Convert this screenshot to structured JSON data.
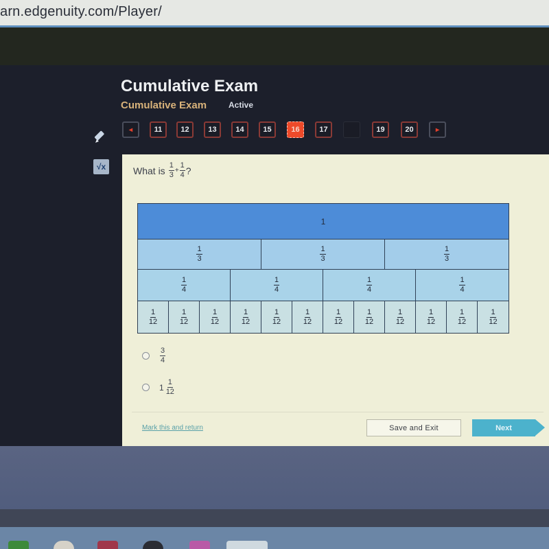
{
  "browser": {
    "url": "arn.edgenuity.com/Player/"
  },
  "header": {
    "title": "Cumulative Exam",
    "subtitle": "Cumulative Exam",
    "status": "Active"
  },
  "nav": {
    "prev_icon": "◂",
    "next_icon": "▸",
    "questions": [
      {
        "label": "11",
        "state": "answered"
      },
      {
        "label": "12",
        "state": "answered"
      },
      {
        "label": "13",
        "state": "answered"
      },
      {
        "label": "14",
        "state": "answered"
      },
      {
        "label": "15",
        "state": "answered"
      },
      {
        "label": "16",
        "state": "current"
      },
      {
        "label": "17",
        "state": "answered"
      },
      {
        "label": "",
        "state": "blank"
      },
      {
        "label": "19",
        "state": "answered"
      },
      {
        "label": "20",
        "state": "answered"
      }
    ],
    "current_color": "#ee4a2a"
  },
  "tools": {
    "pencil": "pencil-icon",
    "math": "√x"
  },
  "question": {
    "prefix": "What is",
    "frac1": {
      "num": "1",
      "den": "3"
    },
    "operator": "+",
    "frac2": {
      "num": "1",
      "den": "4"
    },
    "suffix": "?"
  },
  "fraction_model": {
    "whole": "1",
    "thirds": [
      {
        "num": "1",
        "den": "3"
      },
      {
        "num": "1",
        "den": "3"
      },
      {
        "num": "1",
        "den": "3"
      }
    ],
    "fourths": [
      {
        "num": "1",
        "den": "4"
      },
      {
        "num": "1",
        "den": "4"
      },
      {
        "num": "1",
        "den": "4"
      },
      {
        "num": "1",
        "den": "4"
      }
    ],
    "twelfths": [
      {
        "num": "1",
        "den": "12"
      },
      {
        "num": "1",
        "den": "12"
      },
      {
        "num": "1",
        "den": "12"
      },
      {
        "num": "1",
        "den": "12"
      },
      {
        "num": "1",
        "den": "12"
      },
      {
        "num": "1",
        "den": "12"
      },
      {
        "num": "1",
        "den": "12"
      },
      {
        "num": "1",
        "den": "12"
      },
      {
        "num": "1",
        "den": "12"
      },
      {
        "num": "1",
        "den": "12"
      },
      {
        "num": "1",
        "den": "12"
      },
      {
        "num": "1",
        "den": "12"
      }
    ]
  },
  "choices": [
    {
      "whole": "",
      "num": "3",
      "den": "4"
    },
    {
      "whole": "1",
      "num": "1",
      "den": "12"
    }
  ],
  "footer": {
    "mark_link": "Mark this and return",
    "save_exit": "Save and Exit",
    "next": "Next"
  }
}
